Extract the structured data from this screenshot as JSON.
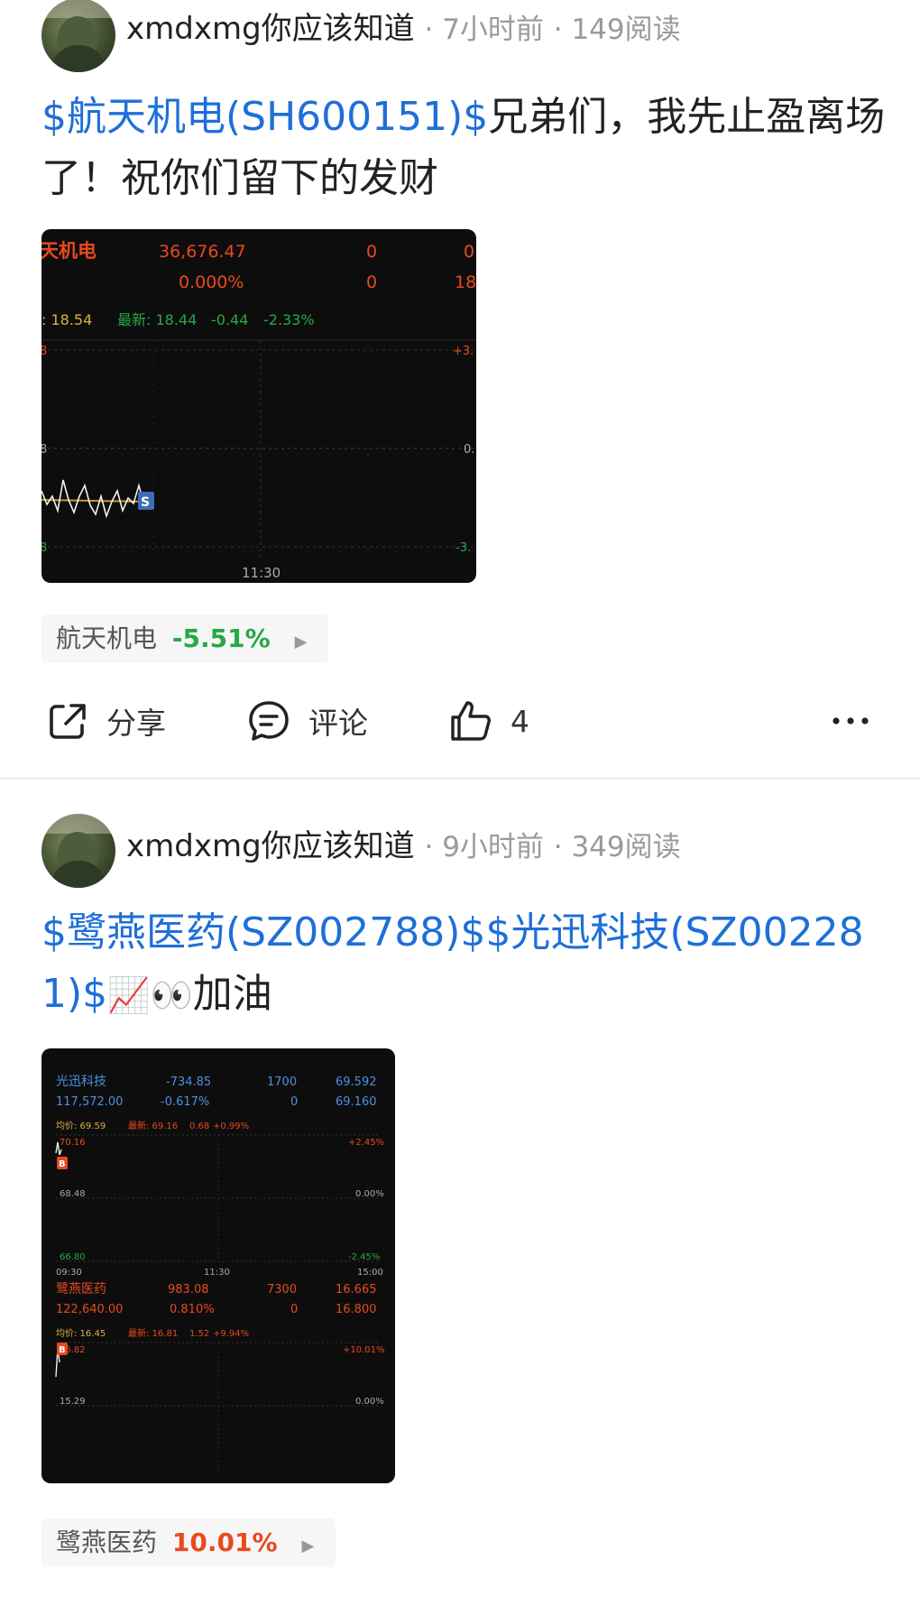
{
  "posts": [
    {
      "author": "xmdxmg你应该知道",
      "time": "7小时前",
      "reads": "149阅读",
      "title_stock": "$航天机电(SH600151)$",
      "title_text": "兄弟们，我先止盈离场了！祝你们留下的发财",
      "chart": {
        "name": "天机电",
        "amount": "36,676.47",
        "ratio": "0.000%",
        "col3_top": "0",
        "col3_bottom": "0",
        "col4_top": "0",
        "col4_bottom": "18",
        "avg": ": 18.54",
        "latest": "最新: 18.44",
        "change": "-0.44",
        "change_pct": "-2.33%",
        "left_top": "8",
        "left_mid": "8",
        "left_bottom": "8",
        "right_top": "+3.",
        "right_mid": "0.",
        "right_bottom": "-3.",
        "time_mid": "11:30",
        "marker": "S"
      },
      "stock_tag": {
        "name": "航天机电",
        "pct": "-5.51%",
        "color": "#27a847"
      },
      "actions": {
        "share": "分享",
        "comment": "评论",
        "like_count": "4"
      }
    },
    {
      "author": "xmdxmg你应该知道",
      "time": "9小时前",
      "reads": "349阅读",
      "title_stock": "$鹭燕医药(SZ002788)$$光迅科技(SZ002281)$",
      "title_emoji": "📈👀",
      "title_text": "加油",
      "chart": {
        "s1_name": "光迅科技",
        "s1_amount": "117,572.00",
        "s1_v1": "-734.85",
        "s1_v2": "-0.617%",
        "s1_v3": "1700",
        "s1_v4": "0",
        "s1_v5": "69.592",
        "s1_v6": "69.160",
        "s1_avg": "均价: 69.59",
        "s1_latest": "最新: 69.16",
        "s1_chg": "0.68",
        "s1_pct": "+0.99%",
        "s1_top": "70.16",
        "s1_mid": "68.48",
        "s1_bottom": "66.80",
        "s1_rtop": "+2.45%",
        "s1_rmid": "0.00%",
        "s1_rbottom": "-2.45%",
        "t_start": "09:30",
        "t_mid": "11:30",
        "t_end": "15:00",
        "s2_name": "鹭燕医药",
        "s2_amount": "122,640.00",
        "s2_v1": "983.08",
        "s2_v2": "0.810%",
        "s2_v3": "7300",
        "s2_v4": "0",
        "s2_v5": "16.665",
        "s2_v6": "16.800",
        "s2_avg": "均价: 16.45",
        "s2_latest": "最新: 16.81",
        "s2_chg": "1.52",
        "s2_pct": "+9.94%",
        "s2_top": "16.82",
        "s2_mid": "15.29",
        "s2_rtop": "+10.01%",
        "s2_rmid": "0.00%",
        "marker": "B"
      },
      "stock_tag": {
        "name": "鹭燕医药",
        "pct": "10.01%",
        "color": "#e8491d"
      }
    }
  ],
  "colors": {
    "stock_link": "#1e6fd9",
    "up": "#e8491d",
    "down": "#27a847"
  }
}
